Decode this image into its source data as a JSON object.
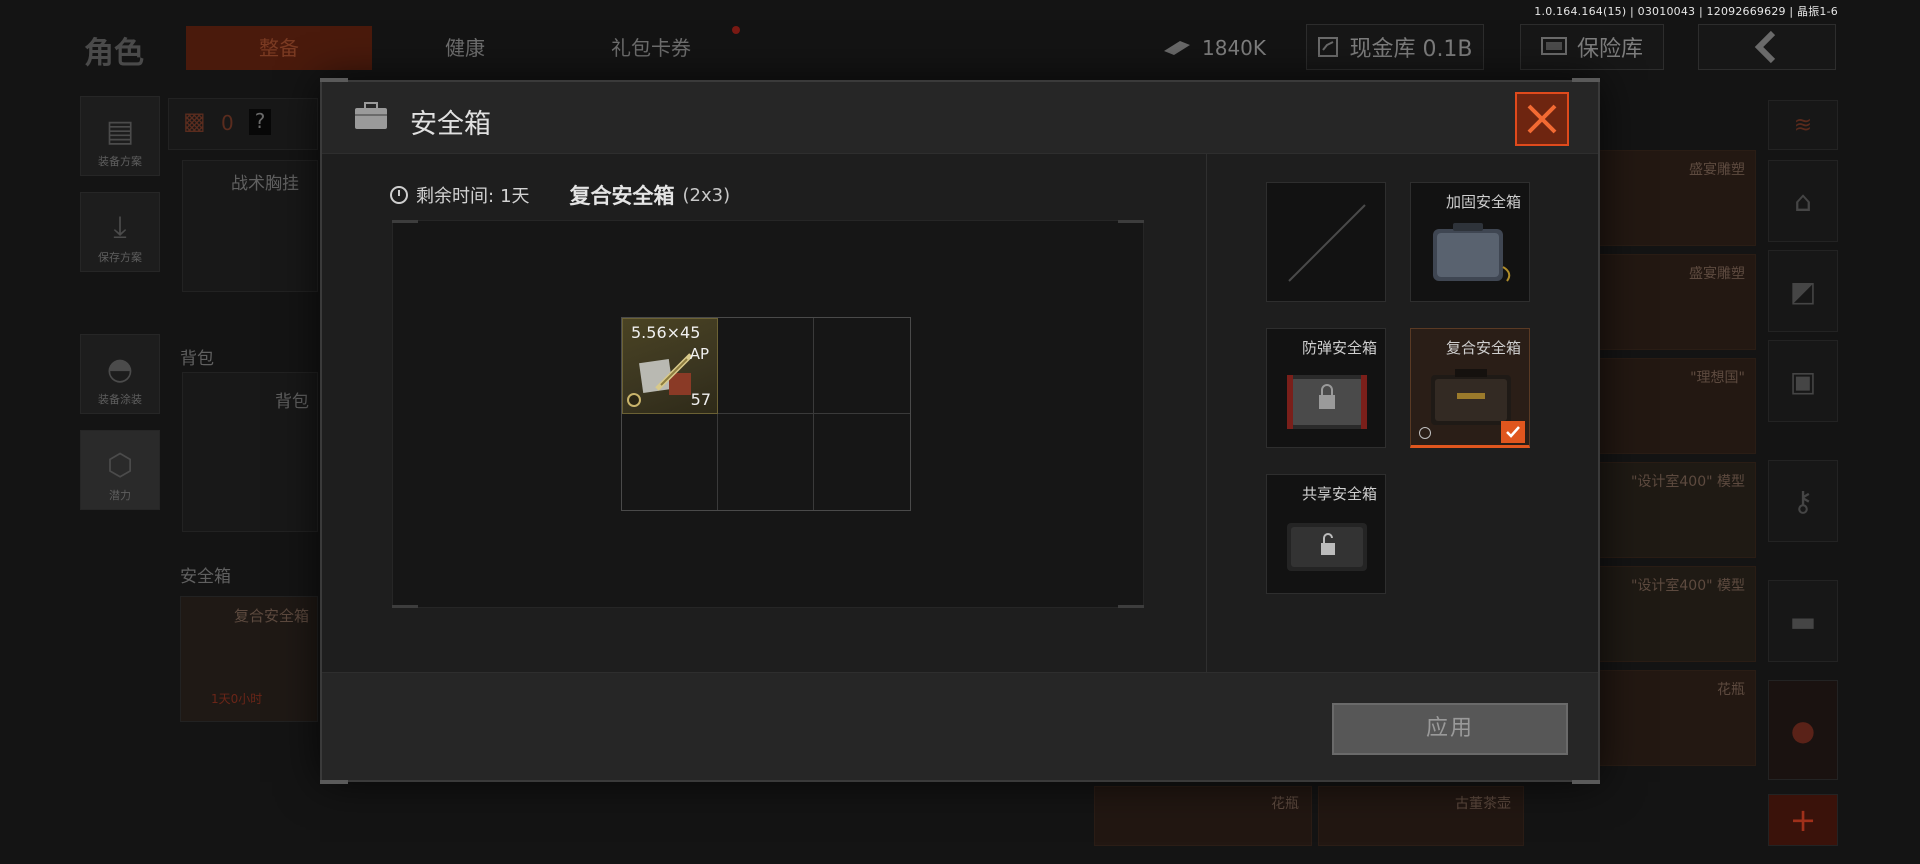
{
  "version": "1.0.164.164(15) | 03010043 | 12092669629 | 晶振1-6",
  "screen": {
    "title": "角色",
    "tabs": [
      {
        "label": "整备",
        "active": true
      },
      {
        "label": "健康",
        "active": false
      },
      {
        "label": "礼包卡券",
        "active": false
      }
    ],
    "currency": {
      "value": "1840K"
    },
    "cash_vault": {
      "label": "现金库 0.1B"
    },
    "insurance": {
      "label": "保险库"
    },
    "left_menu": [
      "装备方案",
      "保存方案",
      "装备涂装",
      "潜力"
    ],
    "armor_count": "0",
    "armor_help": "?",
    "chest_rig_label": "战术胸挂",
    "backpack_section": "背包",
    "backpack_label": "背包",
    "safe_section": "安全箱",
    "safe_label": "复合安全箱",
    "safe_time": "1天0小时",
    "right_cards": [
      "盛宴雕塑",
      "盛宴雕塑",
      "\"理想国\"",
      "\"设计室400\" 模型",
      "\"设计室400\" 模型",
      "花瓶"
    ],
    "bottom_cards": [
      "花瓶",
      "古董茶壶"
    ]
  },
  "modal": {
    "title": "安全箱",
    "remaining_label": "剩余时间:",
    "remaining_value": "1天",
    "case_name": "复合安全箱",
    "case_size": "(2x3)",
    "item": {
      "name": "5.56×45",
      "tag": "AP",
      "count": "57"
    },
    "options": [
      {
        "label": "",
        "selected": false,
        "locked": false
      },
      {
        "label": "加固安全箱",
        "selected": false,
        "locked": false
      },
      {
        "label": "防弹安全箱",
        "selected": false,
        "locked": true
      },
      {
        "label": "复合安全箱",
        "selected": true,
        "locked": false
      },
      {
        "label": "共享安全箱",
        "selected": false,
        "locked": true
      }
    ],
    "apply_label": "应用"
  },
  "colors": {
    "accent": "#e0561e",
    "close_bg": "#6e2510",
    "ammo_bg": "#4a4323"
  }
}
